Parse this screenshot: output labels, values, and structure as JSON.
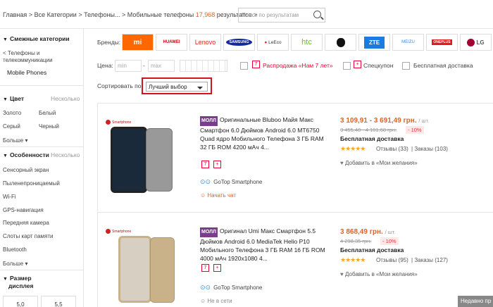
{
  "breadcrumb": {
    "home": "Главная",
    "all": "Все Категории",
    "phones": "Телефоны...",
    "mobile": "Мобильные телефоны",
    "count": "17,968",
    "results": "результатов",
    "sep": ">"
  },
  "search": {
    "placeholder": "Поиск по результатам"
  },
  "sidebar": {
    "related": {
      "title": "Смежные категории",
      "back": "< Телефоны и",
      "back2": "телекоммуникации",
      "current": "Mobile Phones"
    },
    "color": {
      "title": "Цвет",
      "more": "Несколько",
      "items": [
        "Золото",
        "Белый",
        "Серый",
        "Черный"
      ],
      "expand": "Больше"
    },
    "features": {
      "title": "Особенности",
      "more": "Несколько",
      "items": [
        "Сенсорный экран",
        "Пыленепроницаемый",
        "Wi-Fi",
        "GPS-навигация",
        "Передняя камера",
        "Слоты карт памяти",
        "Bluetooth"
      ],
      "expand": "Больше"
    },
    "display": {
      "title": "Размер",
      "title2": "дисплея",
      "sizes": [
        "5,0",
        "5,5"
      ]
    }
  },
  "filters": {
    "brands_label": "Бренды:",
    "brands": [
      {
        "name": "mi",
        "color": "#ff6700"
      },
      {
        "name": "HUAWEI",
        "color": "#c7000b"
      },
      {
        "name": "Lenovo",
        "color": "#e2231a"
      },
      {
        "name": "SAMSUNG",
        "color": "#ffffff"
      },
      {
        "name": "LeEco",
        "color": "#333333"
      },
      {
        "name": "htc",
        "color": "#69be28"
      },
      {
        "name": "apple",
        "color": "#111111"
      },
      {
        "name": "ZTE",
        "color": "#ffffff"
      },
      {
        "name": "MEIZU",
        "color": "#3b8ee6"
      },
      {
        "name": "ONEPLUS",
        "color": "#ffffff"
      },
      {
        "name": "LG",
        "color": "#a50034"
      }
    ],
    "price_label": "Цена:",
    "min": "min",
    "dash": "-",
    "max": "max",
    "sale": "Распродажа «Нам 7 лет»",
    "spec": "Спецкупон",
    "free": "Бесплатная доставка",
    "sort_label": "Сортировать по:",
    "sort_value": "Лучший выбор"
  },
  "products": [
    {
      "store": "Smartphone",
      "mall": "МОЛЛ",
      "title": "Оригинальные Bluboo Майя Макс Смартфон 6.0 Дюймов Android 6.0 MT6750 Quad ядро Мобильного Телефона 3 ГБ RAM 32 ГБ ROM 4200 мАч 4...",
      "price": "3 109,91 - 3 691,49 грн.",
      "unit": "/ шт.",
      "old": "3 455,48 - 4 101,68 грн.",
      "discount": "- 10%",
      "shipping": "Бесплатная доставка",
      "stars": "★★★★★",
      "reviews": "Отзывы (33)",
      "orders": "Заказы (103)",
      "wish": "Добавить в «Мои желания»",
      "seller": "GoTop Smartphone",
      "chat": "Начать чат",
      "phone_color": "#999999",
      "screen_color": "#1b2a3a"
    },
    {
      "store": "Smartphone",
      "mall": "МОЛЛ",
      "title": "Оригинал Umi Макс Смартфон 5.5 Дюймов Android 6.0 MediaTek Helio P10 Мобильного Телефона 3 ГБ RAM 16 ГБ ROM 4000 мАч 1920x1080 4...",
      "price": "3 868,49 грн.",
      "unit": "/ шт.",
      "old": "4 298,35 грн.",
      "discount": "- 10%",
      "shipping": "Бесплатная доставка",
      "stars": "★★★★★",
      "reviews": "Отзывы (95)",
      "orders": "Заказы (127)",
      "wish": "Добавить в «Мои желания»",
      "seller": "GoTop Smartphone",
      "chat": "Не в сети",
      "phone_color": "#c9b28a",
      "screen_color": "#d7cfc2"
    }
  ],
  "recent": "Недавно пр"
}
